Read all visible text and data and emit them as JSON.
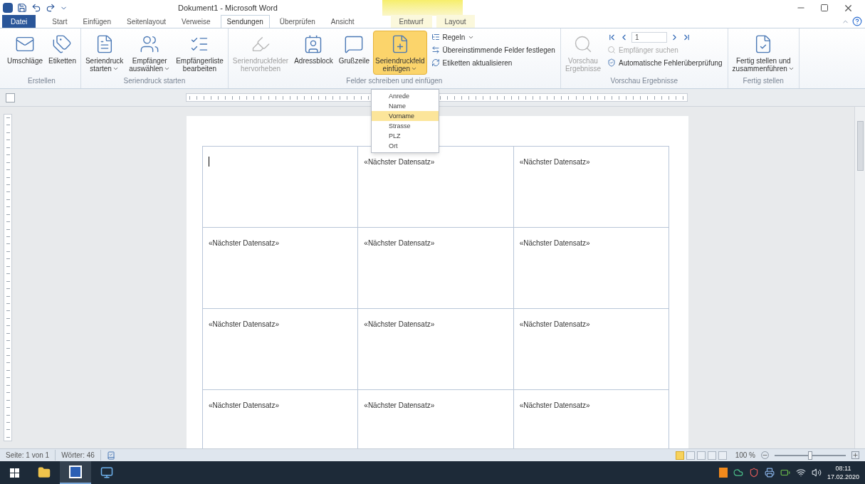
{
  "window": {
    "title": "Dokument1 - Microsoft Word"
  },
  "tabs": [
    {
      "label": "Datei",
      "kind": "file",
      "selected": false
    },
    {
      "label": "Start",
      "kind": "tab",
      "selected": false
    },
    {
      "label": "Einfügen",
      "kind": "tab",
      "selected": false
    },
    {
      "label": "Seitenlayout",
      "kind": "tab",
      "selected": false
    },
    {
      "label": "Verweise",
      "kind": "tab",
      "selected": false
    },
    {
      "label": "Sendungen",
      "kind": "tab",
      "selected": true
    },
    {
      "label": "Überprüfen",
      "kind": "tab",
      "selected": false
    },
    {
      "label": "Ansicht",
      "kind": "tab",
      "selected": false
    },
    {
      "label": "Entwurf",
      "kind": "context",
      "selected": false
    },
    {
      "label": "Layout",
      "kind": "context",
      "selected": false
    }
  ],
  "ribbon_groups": [
    {
      "label": "Erstellen",
      "items": [
        {
          "kind": "large",
          "lines": [
            "Umschläge"
          ],
          "disabled": false,
          "open": false,
          "dropdown": false
        },
        {
          "kind": "large",
          "lines": [
            "Etiketten"
          ],
          "disabled": false,
          "open": false,
          "dropdown": false
        }
      ]
    },
    {
      "label": "Seriendruck starten",
      "items": [
        {
          "kind": "large",
          "lines": [
            "Seriendruck",
            "starten"
          ],
          "disabled": false,
          "open": false,
          "dropdown": true
        },
        {
          "kind": "large",
          "lines": [
            "Empfänger",
            "auswählen"
          ],
          "disabled": false,
          "open": false,
          "dropdown": true
        },
        {
          "kind": "large",
          "lines": [
            "Empfängerliste",
            "bearbeiten"
          ],
          "disabled": false,
          "open": false,
          "dropdown": false
        }
      ]
    },
    {
      "label": "Felder schreiben und einfügen",
      "items": [
        {
          "kind": "large",
          "lines": [
            "Seriendruckfelder",
            "hervorheben"
          ],
          "disabled": true,
          "open": false,
          "dropdown": false
        },
        {
          "kind": "large",
          "lines": [
            "Adressblock"
          ],
          "disabled": false,
          "open": false,
          "dropdown": false
        },
        {
          "kind": "large",
          "lines": [
            "Grußzeile"
          ],
          "disabled": false,
          "open": false,
          "dropdown": false
        },
        {
          "kind": "large",
          "lines": [
            "Seriendruckfeld",
            "einfügen"
          ],
          "disabled": false,
          "open": true,
          "dropdown": true,
          "menu": [
            {
              "label": "Anrede",
              "selected": false
            },
            {
              "label": "Name",
              "selected": false
            },
            {
              "label": "Vorname",
              "selected": true
            },
            {
              "label": "Strasse",
              "selected": false
            },
            {
              "label": "PLZ",
              "selected": false
            },
            {
              "label": "Ort",
              "selected": false
            }
          ]
        },
        {
          "kind": "column",
          "items": [
            {
              "kind": "small",
              "label": "Regeln",
              "disabled": false,
              "dropdown": true
            },
            {
              "kind": "small",
              "label": "Übereinstimmende Felder festlegen",
              "disabled": false,
              "dropdown": false
            },
            {
              "kind": "small",
              "label": "Etiketten aktualisieren",
              "disabled": false,
              "dropdown": false
            }
          ]
        }
      ]
    },
    {
      "label": "Vorschau Ergebnisse",
      "items": [
        {
          "kind": "large",
          "lines": [
            "Vorschau",
            "Ergebnisse"
          ],
          "disabled": true,
          "open": false,
          "dropdown": false
        },
        {
          "kind": "column",
          "items": [
            {
              "kind": "nav",
              "record": "1"
            },
            {
              "kind": "small",
              "label": "Empfänger suchen",
              "disabled": true,
              "dropdown": false
            },
            {
              "kind": "small",
              "label": "Automatische Fehlerüberprüfung",
              "disabled": false,
              "dropdown": false
            }
          ]
        }
      ]
    },
    {
      "label": "Fertig stellen",
      "items": [
        {
          "kind": "large",
          "lines": [
            "Fertig stellen und",
            "zusammenführen"
          ],
          "disabled": false,
          "open": false,
          "dropdown": true
        }
      ]
    }
  ],
  "document": {
    "rows": [
      {
        "cells": [
          {
            "kind": "cursor"
          },
          {
            "kind": "text",
            "text": "«Nächster Datensatz»"
          },
          {
            "kind": "text",
            "text": "«Nächster Datensatz»"
          }
        ]
      },
      {
        "cells": [
          {
            "kind": "text",
            "text": "«Nächster Datensatz»"
          },
          {
            "kind": "text",
            "text": "«Nächster Datensatz»"
          },
          {
            "kind": "text",
            "text": "«Nächster Datensatz»"
          }
        ]
      },
      {
        "cells": [
          {
            "kind": "text",
            "text": "«Nächster Datensatz»"
          },
          {
            "kind": "text",
            "text": "«Nächster Datensatz»"
          },
          {
            "kind": "text",
            "text": "«Nächster Datensatz»"
          }
        ]
      },
      {
        "cells": [
          {
            "kind": "text",
            "text": "«Nächster Datensatz»"
          },
          {
            "kind": "text",
            "text": "«Nächster Datensatz»"
          },
          {
            "kind": "text",
            "text": "«Nächster Datensatz»"
          }
        ]
      }
    ]
  },
  "status_bar": {
    "page": "Seite: 1 von 1",
    "words": "Wörter: 46",
    "views": [
      {
        "selected": true
      },
      {
        "selected": false
      },
      {
        "selected": false
      },
      {
        "selected": false
      },
      {
        "selected": false
      }
    ],
    "zoom": "100 %",
    "zoom_slider": {
      "level": 0.5
    }
  },
  "taskbar": {
    "apps": [
      {
        "kind": "explorer",
        "selected": false
      },
      {
        "kind": "word",
        "selected": true
      },
      {
        "kind": "remote",
        "selected": false
      }
    ],
    "time": "08:11",
    "date": "17.02.2020"
  }
}
